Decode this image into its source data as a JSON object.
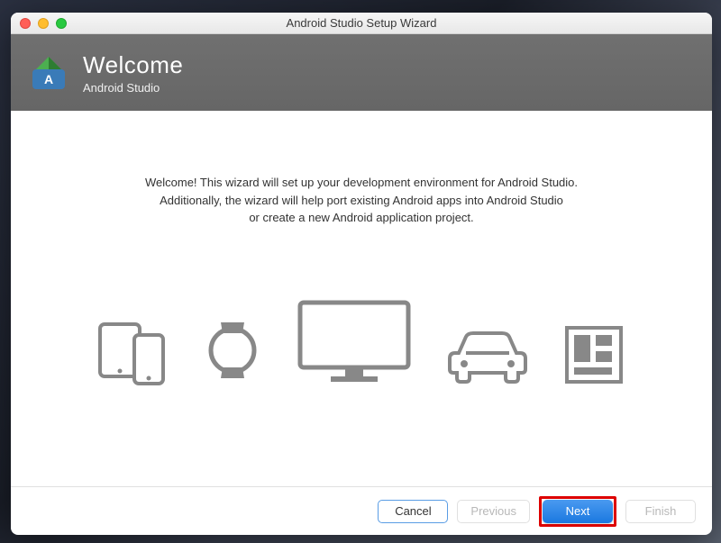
{
  "window": {
    "title": "Android Studio Setup Wizard"
  },
  "banner": {
    "title": "Welcome",
    "subtitle": "Android Studio"
  },
  "content": {
    "line1": "Welcome! This wizard will set up your development environment for Android Studio.",
    "line2": "Additionally, the wizard will help port existing Android apps into Android Studio",
    "line3": "or create a new Android application project."
  },
  "buttons": {
    "cancel": "Cancel",
    "previous": "Previous",
    "next": "Next",
    "finish": "Finish"
  }
}
